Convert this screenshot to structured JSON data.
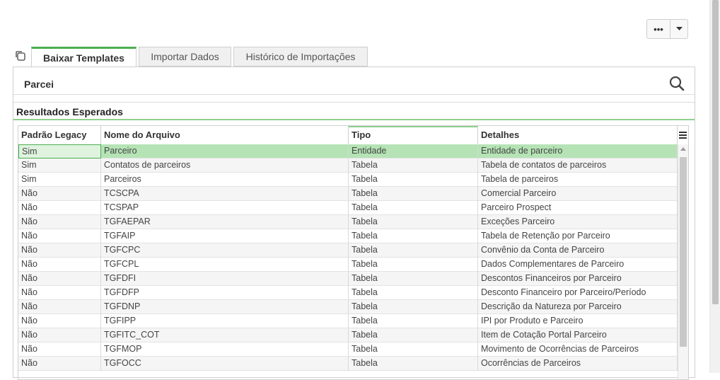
{
  "toolbar": {
    "more_label": "•••",
    "more_icon": "ellipsis-icon",
    "caret_icon": "caret-down-icon"
  },
  "tabs": [
    {
      "label": "Baixar Templates",
      "active": true
    },
    {
      "label": "Importar Dados",
      "active": false
    },
    {
      "label": "Histórico de Importações",
      "active": false
    }
  ],
  "search": {
    "value": "Parcei",
    "icon": "search-icon"
  },
  "section": {
    "title": "Resultados Esperados"
  },
  "grid": {
    "columns": [
      "Padrão Legacy",
      "Nome do Arquivo",
      "Tipo",
      "Detalhes"
    ],
    "rows": [
      [
        "Sim",
        "Parceiro",
        "Entidade",
        "Entidade de parceiro"
      ],
      [
        "Sim",
        "Contatos de parceiros",
        "Tabela",
        "Tabela de contatos de parceiros"
      ],
      [
        "Sim",
        "Parceiros",
        "Tabela",
        "Tabela de parceiros"
      ],
      [
        "Não",
        "TCSCPA",
        "Tabela",
        "Comercial Parceiro"
      ],
      [
        "Não",
        "TCSPAP",
        "Tabela",
        "Parceiro Prospect"
      ],
      [
        "Não",
        "TGFAEPAR",
        "Tabela",
        "Exceções Parceiro"
      ],
      [
        "Não",
        "TGFAIP",
        "Tabela",
        "Tabela de Retenção por Parceiro"
      ],
      [
        "Não",
        "TGFCPC",
        "Tabela",
        "Convênio da Conta de Parceiro"
      ],
      [
        "Não",
        "TGFCPL",
        "Tabela",
        "Dados Complementares de Parceiro"
      ],
      [
        "Não",
        "TGFDFI",
        "Tabela",
        "Descontos Financeiros por Parceiro"
      ],
      [
        "Não",
        "TGFDFP",
        "Tabela",
        "Desconto Financeiro por Parceiro/Período"
      ],
      [
        "Não",
        "TGFDNP",
        "Tabela",
        "Descrição da Natureza por Parceiro"
      ],
      [
        "Não",
        "TGFIPP",
        "Tabela",
        "IPI por Produto e Parceiro"
      ],
      [
        "Não",
        "TGFITC_COT",
        "Tabela",
        "Item de Cotação Portal Parceiro"
      ],
      [
        "Não",
        "TGFMOP",
        "Tabela",
        "Movimento de Ocorrências de Parceiros"
      ],
      [
        "Não",
        "TGFOCC",
        "Tabela",
        "Ocorrências de Parceiros"
      ]
    ]
  },
  "colors": {
    "accent": "#4caf50",
    "selected_row": "#b5e3b5"
  }
}
